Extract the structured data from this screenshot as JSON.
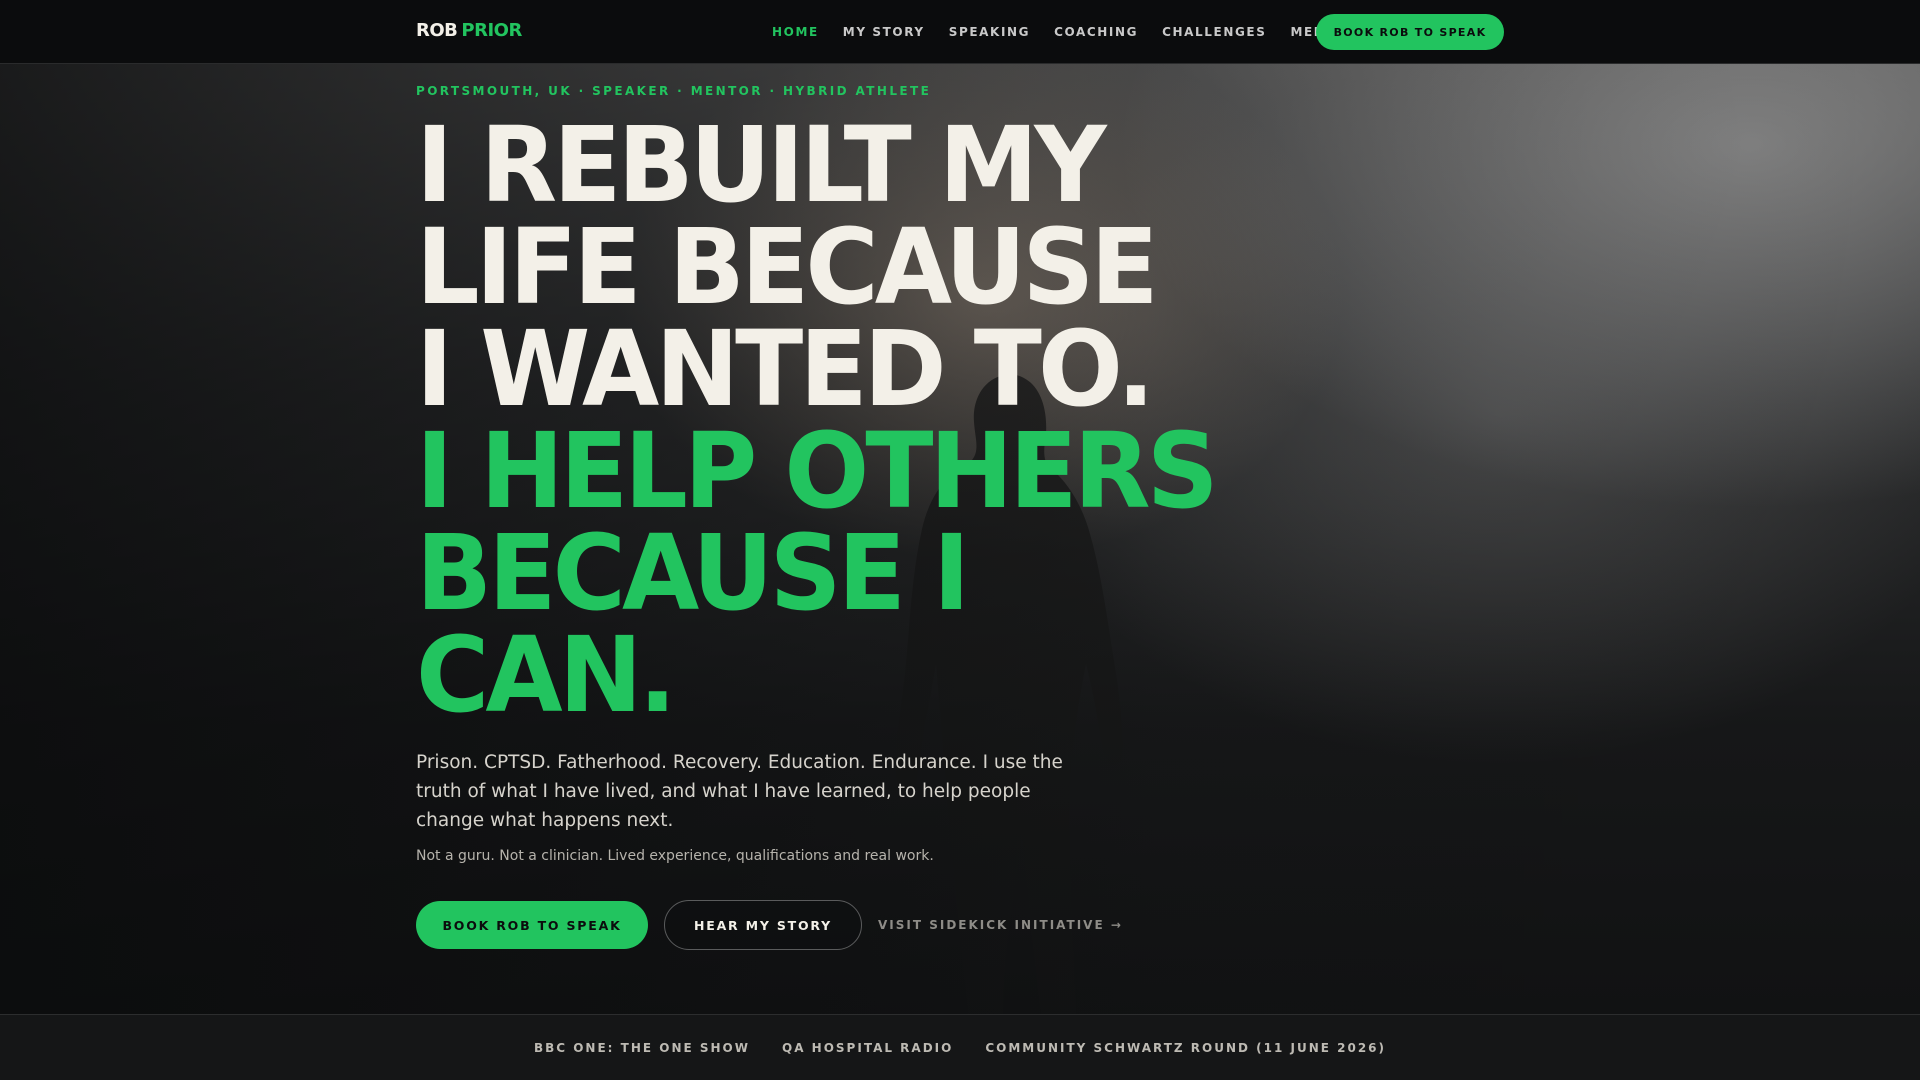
{
  "brand": {
    "logo_first": "ROB",
    "logo_second": "PRIOR",
    "accent_color": "#22c45f",
    "text_color": "#f3f0e8",
    "background_color": "#0e0f10"
  },
  "nav": {
    "items": [
      {
        "label": "HOME",
        "active": true
      },
      {
        "label": "MY STORY",
        "active": false
      },
      {
        "label": "SPEAKING",
        "active": false
      },
      {
        "label": "COACHING",
        "active": false
      },
      {
        "label": "CHALLENGES",
        "active": false
      },
      {
        "label": "MEDIA",
        "active": false
      }
    ],
    "cta_label": "BOOK ROB TO SPEAK"
  },
  "hero": {
    "eyebrow": "PORTSMOUTH, UK · SPEAKER · MENTOR · HYBRID ATHLETE",
    "headline_lines": [
      "I REBUILT MY",
      "LIFE BECAUSE",
      "I WANTED TO.",
      "I HELP OTHERS",
      "BECAUSE I",
      "CAN."
    ],
    "lede": "Prison. CPTSD. Fatherhood. Recovery. Education. Endurance. I use the truth of what I have lived, and what I have learned, to help people change what happens next.",
    "subnote": "Not a guru. Not a clinician. Lived experience, qualifications and real work.",
    "primary_button": "BOOK ROB TO SPEAK",
    "secondary_button": "HEAR MY STORY",
    "text_link": "VISIT SIDEKICK INITIATIVE →",
    "background_image": "hiker-silhouette-in-fog"
  },
  "media_strip": {
    "items": [
      "BBC ONE: THE ONE SHOW",
      "QA HOSPITAL RADIO",
      "COMMUNITY SCHWARTZ ROUND (11 JUNE 2026)"
    ]
  }
}
